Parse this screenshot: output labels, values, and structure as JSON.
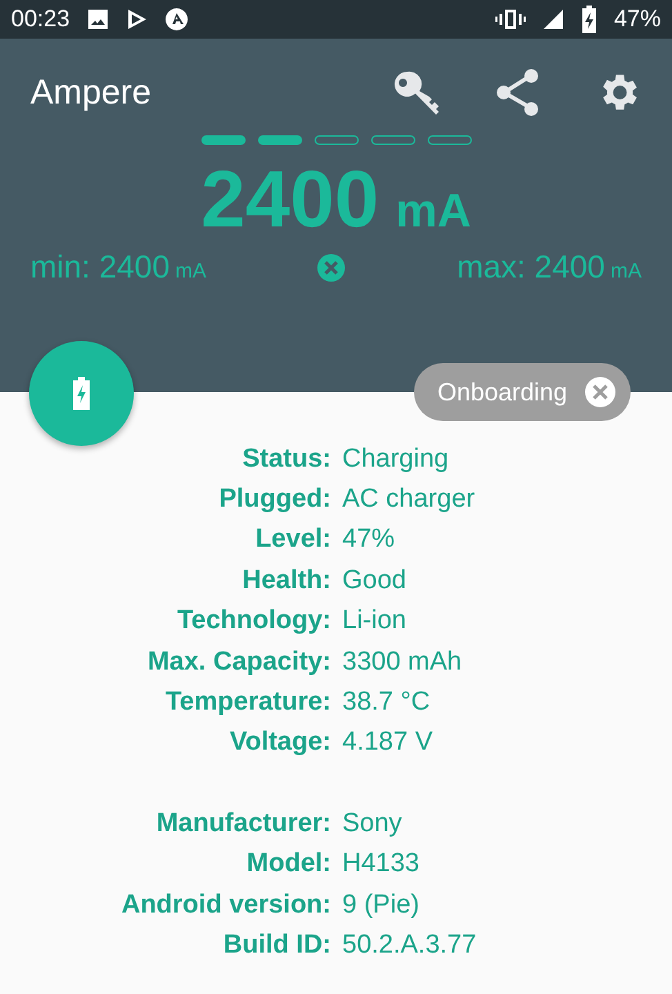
{
  "status_bar": {
    "time": "00:23",
    "battery": "47%"
  },
  "app_bar": {
    "title": "Ampere"
  },
  "pager": [
    {
      "on": true
    },
    {
      "on": true
    },
    {
      "on": false
    },
    {
      "on": false
    },
    {
      "on": false
    }
  ],
  "current": {
    "value": "2400",
    "unit": "mA"
  },
  "min": {
    "label": "min: 2400",
    "unit": "mA"
  },
  "max": {
    "label": "max: 2400",
    "unit": "mA"
  },
  "chip": {
    "label": "Onboarding"
  },
  "sections": [
    {
      "rows": [
        {
          "label": "Status:",
          "value": "Charging"
        },
        {
          "label": "Plugged:",
          "value": "AC charger"
        },
        {
          "label": "Level:",
          "value": "47%"
        },
        {
          "label": "Health:",
          "value": "Good"
        },
        {
          "label": "Technology:",
          "value": "Li-ion"
        },
        {
          "label": "Max. Capacity:",
          "value": "3300 mAh"
        },
        {
          "label": "Temperature:",
          "value": "38.7 °C"
        },
        {
          "label": "Voltage:",
          "value": "4.187 V"
        }
      ]
    },
    {
      "rows": [
        {
          "label": "Manufacturer:",
          "value": "Sony"
        },
        {
          "label": "Model:",
          "value": "H4133"
        },
        {
          "label": "Android version:",
          "value": "9 (Pie)"
        },
        {
          "label": "Build ID:",
          "value": "50.2.A.3.77"
        }
      ]
    }
  ]
}
